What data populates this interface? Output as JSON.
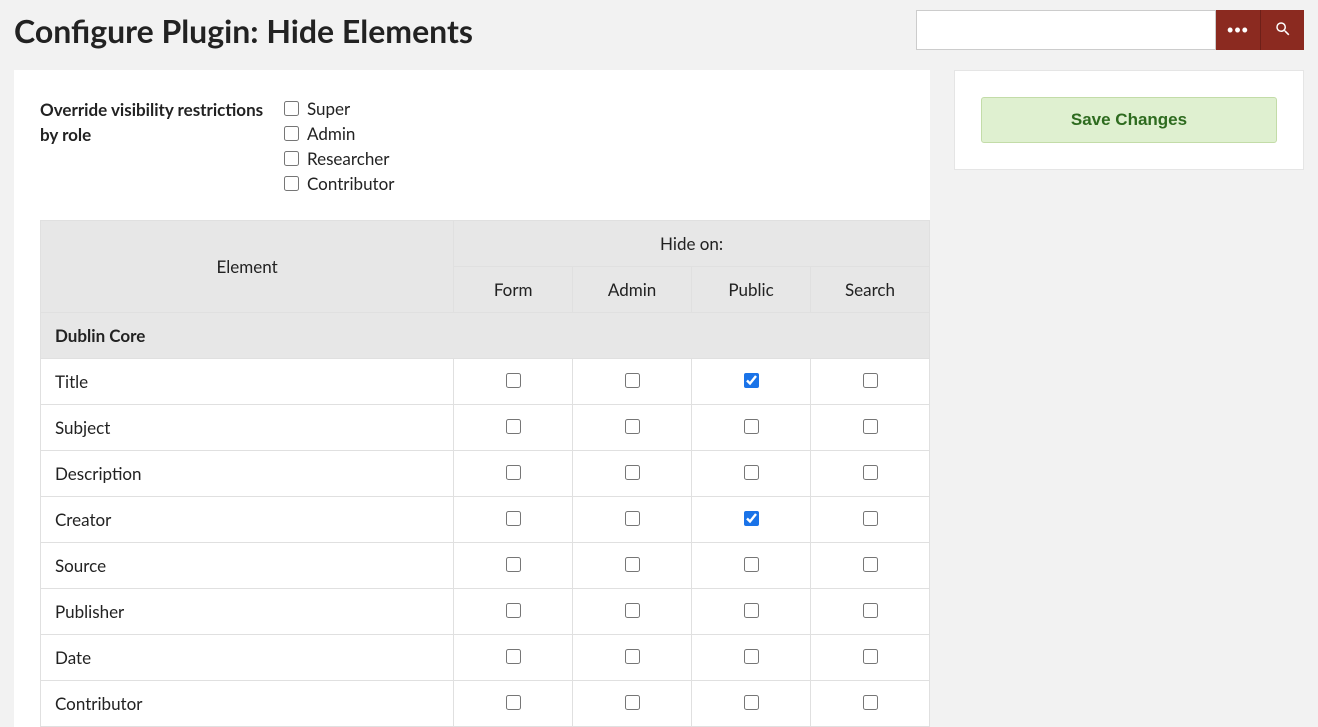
{
  "header": {
    "title": "Configure Plugin: Hide Elements",
    "search_placeholder": ""
  },
  "override": {
    "label": "Override visibility restrictions by role",
    "roles": [
      {
        "label": "Super",
        "checked": false
      },
      {
        "label": "Admin",
        "checked": false
      },
      {
        "label": "Researcher",
        "checked": false
      },
      {
        "label": "Contributor",
        "checked": false
      }
    ]
  },
  "table": {
    "element_header": "Element",
    "hide_on_header": "Hide on:",
    "columns": [
      "Form",
      "Admin",
      "Public",
      "Search"
    ],
    "section_title": "Dublin Core",
    "rows": [
      {
        "name": "Title",
        "checks": [
          false,
          false,
          true,
          false
        ]
      },
      {
        "name": "Subject",
        "checks": [
          false,
          false,
          false,
          false
        ]
      },
      {
        "name": "Description",
        "checks": [
          false,
          false,
          false,
          false
        ]
      },
      {
        "name": "Creator",
        "checks": [
          false,
          false,
          true,
          false
        ]
      },
      {
        "name": "Source",
        "checks": [
          false,
          false,
          false,
          false
        ]
      },
      {
        "name": "Publisher",
        "checks": [
          false,
          false,
          false,
          false
        ]
      },
      {
        "name": "Date",
        "checks": [
          false,
          false,
          false,
          false
        ]
      },
      {
        "name": "Contributor",
        "checks": [
          false,
          false,
          false,
          false
        ]
      }
    ]
  },
  "sidebar": {
    "save_label": "Save Changes"
  }
}
